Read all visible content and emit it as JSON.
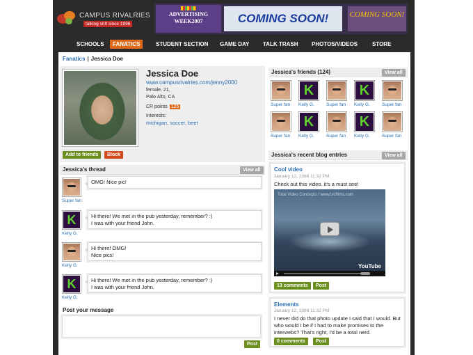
{
  "header": {
    "site_name": "CAMPUS RIVALRIES",
    "tagline": "talking sh!t since 1996"
  },
  "ad": {
    "panel1": "ADVERTISING WEEK2007",
    "panel2": "COMING SOON!",
    "panel3": "COMING SOON!"
  },
  "nav": {
    "items": [
      {
        "label": "SCHOOLS",
        "active": false
      },
      {
        "label": "FANATICS",
        "active": true
      },
      {
        "label": "STUDENT SECTION",
        "active": false
      },
      {
        "label": "GAME DAY",
        "active": false
      },
      {
        "label": "TALK TRASH",
        "active": false
      },
      {
        "label": "PHOTOS/VIDEOS",
        "active": false
      },
      {
        "label": "STORE",
        "active": false
      }
    ]
  },
  "breadcrumb": {
    "parent": "Fanatics",
    "separator": "|",
    "current": "Jessica Doe"
  },
  "profile": {
    "name": "Jessica Doe",
    "url": "www.campusrivalries.com/jenny2000",
    "info_line1": "female, 21,",
    "info_line2": "Palo Alto, CA",
    "points_label": "CR points",
    "points_value": "125",
    "interests_label": "Interests:",
    "interests": [
      "michigan",
      "soccer",
      "beer"
    ],
    "add_friend_label": "Add to friends",
    "block_label": "Block"
  },
  "thread": {
    "title": "Jessica's thread",
    "view_all_label": "View all",
    "messages": [
      {
        "author": "Super fan",
        "avatar": "superfan",
        "lines": [
          "OMG! Nice pic!"
        ]
      },
      {
        "author": "Kelly G.",
        "avatar": "k",
        "lines": [
          "Hi there! We met in the pub yesterday, remember? :)",
          "I was with your friend John."
        ]
      },
      {
        "author": "Kelly G.",
        "avatar": "superfan",
        "lines": [
          "Hi there! OMG!",
          "Nice pics!"
        ]
      },
      {
        "author": "Kelly G.",
        "avatar": "k",
        "lines": [
          "Hi there! We met in the pub yesterday, remember? :)",
          "I was with your friend John."
        ]
      }
    ]
  },
  "post": {
    "title": "Post your message",
    "placeholder": "",
    "button_label": "Post"
  },
  "friends": {
    "title": "Jessica's friends (124)",
    "view_all_label": "View all",
    "items": [
      {
        "name": "Super fan",
        "avatar": "superfan"
      },
      {
        "name": "Kelly G.",
        "avatar": "k"
      },
      {
        "name": "Super fan",
        "avatar": "superfan"
      },
      {
        "name": "Kelly G.",
        "avatar": "k"
      },
      {
        "name": "Super fan",
        "avatar": "superfan"
      },
      {
        "name": "Super fan",
        "avatar": "superfan"
      },
      {
        "name": "Kelly G.",
        "avatar": "k"
      },
      {
        "name": "Super fan",
        "avatar": "superfan"
      },
      {
        "name": "Kelly G.",
        "avatar": "k"
      },
      {
        "name": "Super fan",
        "avatar": "superfan"
      }
    ]
  },
  "blog": {
    "title": "Jessica's recent blog entries",
    "view_all_label": "View all",
    "entries": [
      {
        "title": "Cool video",
        "date": "January 12, 1986 11:32 PM",
        "text": "Check out this video. it's a must see!",
        "video_source": "Total Video Concepts / www.tvcfilms.com",
        "video_brand": "YouTube",
        "comments_label": "13 comments",
        "post_label": "Post"
      },
      {
        "title": "Elements",
        "date": "January 12, 1986 11:32 PM",
        "text": "I never did do that photo update I said that I would. But who would I be if I had to make promises to the interwebs? That's right, I'd be a total nerd.",
        "comments_label": "0 comments",
        "post_label": "Post"
      }
    ]
  },
  "colors": {
    "accent_orange": "#e06a1b",
    "button_green": "#6a8f1d",
    "button_red": "#d34a1a",
    "link_blue": "#2a6fb3",
    "header_dark": "#2b2b2b",
    "avatar_k_bg": "#2c0f3f",
    "avatar_k_fg": "#5fd02d"
  }
}
